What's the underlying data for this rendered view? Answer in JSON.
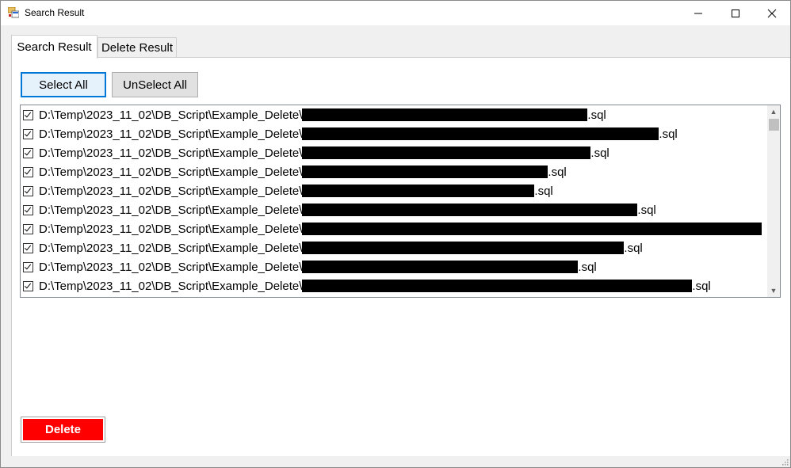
{
  "window": {
    "title": "Search Result",
    "controls": {
      "minimize": "—",
      "maximize": "☐",
      "close": "✕"
    }
  },
  "tabs": [
    {
      "label": "Search Result",
      "selected": true
    },
    {
      "label": "Delete Result",
      "selected": false
    }
  ],
  "toolbar": {
    "select_all": "Select All",
    "unselect_all": "UnSelect All"
  },
  "list": {
    "items": [
      {
        "prefix": "D:\\Temp\\2023_11_02\\DB_Script\\Example_Delete\\",
        "suffix": ".sql",
        "checked": true
      },
      {
        "prefix": "D:\\Temp\\2023_11_02\\DB_Script\\Example_Delete\\",
        "suffix": ".sql",
        "checked": true
      },
      {
        "prefix": "D:\\Temp\\2023_11_02\\DB_Script\\Example_Delete\\",
        "suffix": ".sql",
        "checked": true
      },
      {
        "prefix": "D:\\Temp\\2023_11_02\\DB_Script\\Example_Delete\\",
        "suffix": ".sql",
        "checked": true
      },
      {
        "prefix": "D:\\Temp\\2023_11_02\\DB_Script\\Example_Delete\\",
        "suffix": ".sql",
        "checked": true
      },
      {
        "prefix": "D:\\Temp\\2023_11_02\\DB_Script\\Example_Delete\\",
        "suffix": ".sql",
        "checked": true
      },
      {
        "prefix": "D:\\Temp\\2023_11_02\\DB_Script\\Example_Delete\\",
        "suffix": "",
        "checked": true
      },
      {
        "prefix": "D:\\Temp\\2023_11_02\\DB_Script\\Example_Delete\\",
        "suffix": ".sql",
        "checked": true
      },
      {
        "prefix": "D:\\Temp\\2023_11_02\\DB_Script\\Example_Delete\\",
        "suffix": ".sql",
        "checked": true
      },
      {
        "prefix": "D:\\Temp\\2023_11_02\\DB_Script\\Example_Delete\\",
        "suffix": ".sql",
        "checked": true
      }
    ]
  },
  "delete_button": {
    "label": "Delete",
    "color": "#ff0000"
  }
}
